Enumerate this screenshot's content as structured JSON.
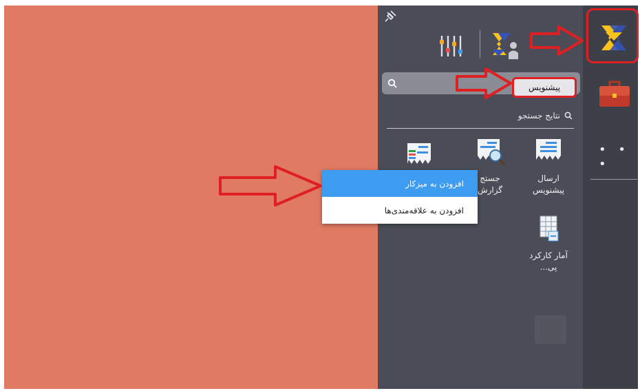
{
  "search": {
    "value": "پیشنویس",
    "placeholder": ""
  },
  "results": {
    "header": "نتایج جستجو"
  },
  "tiles": [
    {
      "line1": "ارسال",
      "line2": "پیشنویس"
    },
    {
      "line1": "جستج",
      "line2": "گزارش"
    },
    {
      "line1": "آمار کارکرد",
      "line2": "پی..."
    }
  ],
  "context_menu": {
    "items": [
      {
        "label": "افزودن به میزکار"
      },
      {
        "label": "افزودن به علاقه‌مندی‌ها"
      }
    ]
  },
  "rail": {
    "more_label": "• • •"
  },
  "colors": {
    "desktop": "#e07a63",
    "panel": "#4a4d57",
    "rail": "#3e4049",
    "annotation_red": "#e01f22",
    "menu_active": "#3d9cf0"
  }
}
